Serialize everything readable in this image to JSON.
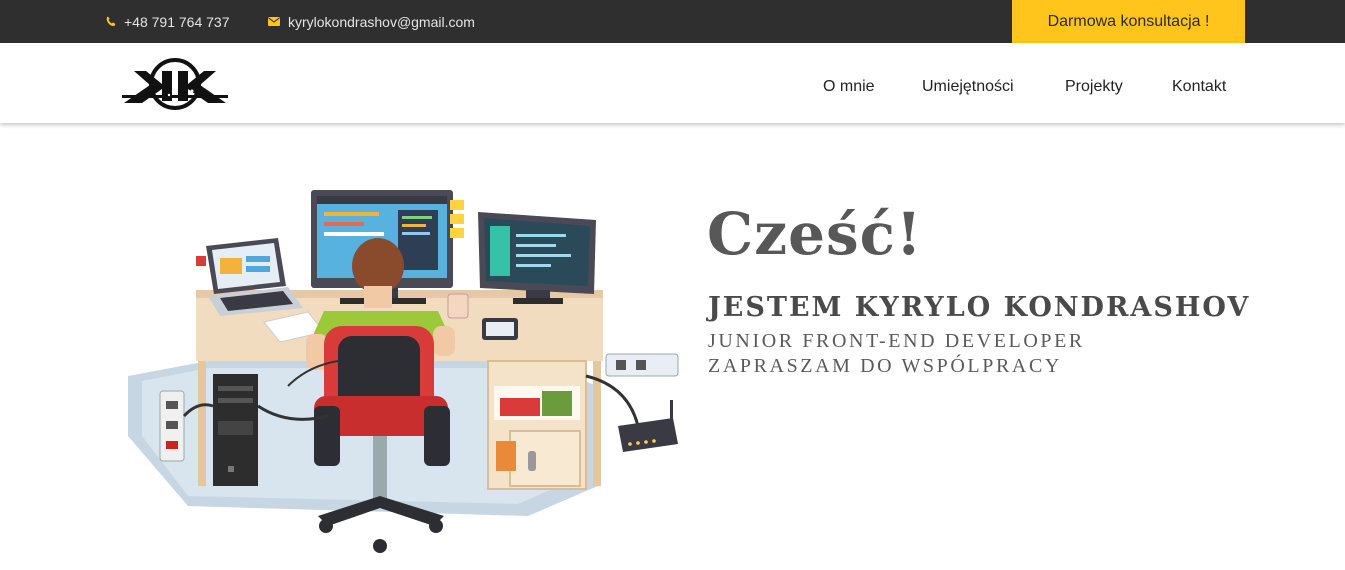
{
  "topbar": {
    "phone": "+48 791 764 737",
    "email": "kyrylokondrashov@gmail.com",
    "cta_label": "Darmowa konsultacja !",
    "phone_icon": "phone-icon",
    "email_icon": "envelope-icon",
    "accent_color": "#ffc51c",
    "background_color": "#2f2f2f"
  },
  "header": {
    "logo_text": "KK",
    "nav": [
      "O mnie",
      "Umiejętności",
      "Projekty",
      "Kontakt"
    ]
  },
  "hero": {
    "greeting": "Cześć!",
    "name": "JESTEM KYRYLO KONDRASHOV",
    "role": "JUNIOR FRONT-END DEVELOPER",
    "invite": "ZAPRASZAM DO WSPÓLPRACY",
    "illustration": "developer-at-desk-illustration"
  }
}
